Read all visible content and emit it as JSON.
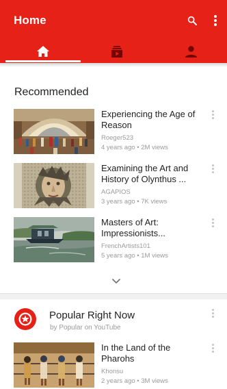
{
  "app_bar": {
    "title": "Home",
    "color": "#e62117"
  },
  "icons": {
    "search": "search-icon",
    "more": "more-vert-icon",
    "home": "home-icon",
    "subscriptions": "subscriptions-icon",
    "account": "account-icon",
    "expand": "chevron-down-icon",
    "channel": "star-badge-icon"
  },
  "tabs": [
    {
      "id": "home",
      "selected": true
    },
    {
      "id": "subscriptions",
      "selected": false
    },
    {
      "id": "account",
      "selected": false
    }
  ],
  "recommended": {
    "heading": "Recommended",
    "videos": [
      {
        "title": "Experiencing the Age of Reason",
        "channel": "Roeger523",
        "meta": "4 years ago • 2M views"
      },
      {
        "title": "Examining the Art and History of Olynthus ...",
        "channel": "AGAPIOS",
        "meta": "3 years ago • 7K views"
      },
      {
        "title": "Masters of Art: Impressionists...",
        "channel": "FrenchArtists101",
        "meta": "5 years ago • 1M views"
      }
    ]
  },
  "popular": {
    "title": "Popular Right Now",
    "byline": "by Popular on YouTube",
    "videos": [
      {
        "title": "In the Land of the Pharohs",
        "channel": "Khonsu",
        "meta": "2 years ago • 3M views"
      }
    ]
  }
}
